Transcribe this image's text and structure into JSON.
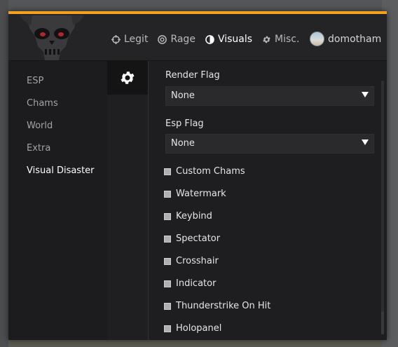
{
  "nav": {
    "tabs": [
      {
        "label": "Legit",
        "icon": "crosshair-icon"
      },
      {
        "label": "Rage",
        "icon": "target-icon"
      },
      {
        "label": "Visuals",
        "icon": "half-circle-icon"
      },
      {
        "label": "Misc.",
        "icon": "gear-icon"
      }
    ],
    "active": "Visuals",
    "user": "domotham"
  },
  "sidebar": {
    "items": [
      {
        "label": "ESP"
      },
      {
        "label": "Chams"
      },
      {
        "label": "World"
      },
      {
        "label": "Extra"
      },
      {
        "label": "Visual Disaster"
      }
    ],
    "active": "Visual Disaster"
  },
  "content": {
    "render_flag": {
      "label": "Render Flag",
      "value": "None"
    },
    "esp_flag": {
      "label": "Esp Flag",
      "value": "None"
    },
    "checkboxes": [
      {
        "label": "Custom Chams",
        "checked": false
      },
      {
        "label": "Watermark",
        "checked": false
      },
      {
        "label": "Keybind",
        "checked": false
      },
      {
        "label": "Spectator",
        "checked": false
      },
      {
        "label": "Crosshair",
        "checked": false
      },
      {
        "label": "Indicator",
        "checked": false
      },
      {
        "label": "Thunderstrike On Hit",
        "checked": false
      },
      {
        "label": "Holopanel",
        "checked": false
      }
    ]
  },
  "colors": {
    "accent": "#f4a21c",
    "panel": "#202022",
    "text": "#e6e6e8"
  }
}
